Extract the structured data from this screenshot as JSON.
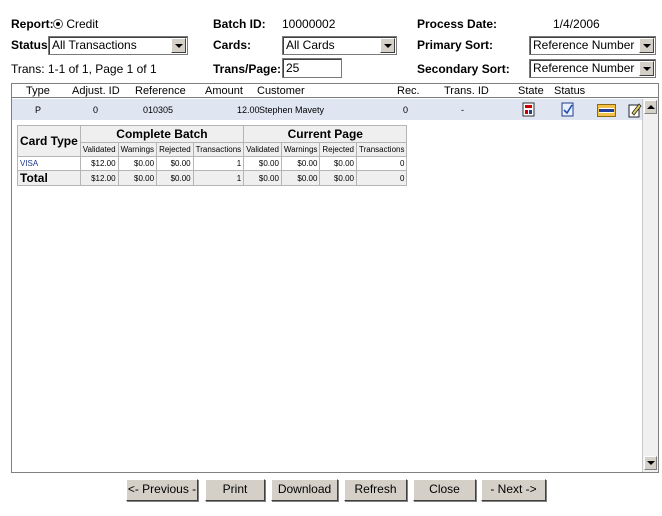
{
  "header": {
    "report_label": "Report:",
    "report_value": "Credit",
    "status_label": "Status:",
    "status_value": "All Transactions",
    "trans_info": "Trans: 1-1 of 1, Page 1 of 1",
    "batch_label": "Batch ID:",
    "batch_value": "10000002",
    "cards_label": "Cards:",
    "cards_value": "All Cards",
    "transpage_label": "Trans/Page:",
    "transpage_value": "25",
    "process_date_label": "Process Date:",
    "process_date_value": "1/4/2006",
    "primary_sort_label": "Primary Sort:",
    "primary_sort_value": "Reference Number",
    "secondary_sort_label": "Secondary Sort:",
    "secondary_sort_value": "Reference Number"
  },
  "columns": [
    "Type",
    "Adjust. ID",
    "Reference",
    "Amount",
    "Customer",
    "Rec.",
    "Trans. ID",
    "State",
    "Status"
  ],
  "row": {
    "type": "P",
    "adjust_id": "0",
    "reference": "010305",
    "amount": "12.00",
    "customer": "Stephen Mavety",
    "rec": "0",
    "trans_id": "-",
    "icons": [
      "state-icon",
      "status-check-icon",
      "visa-card-icon",
      "edit-note-icon"
    ]
  },
  "summary": {
    "card_type_header": "Card Type",
    "complete_batch_header": "Complete Batch",
    "current_page_header": "Current Page",
    "sub_headers": [
      "Validated",
      "Warnings",
      "Rejected",
      "Transactions",
      "Validated",
      "Warnings",
      "Rejected",
      "Transactions"
    ],
    "visa_label": "VISA",
    "visa_values": [
      "$12.00",
      "$0.00",
      "$0.00",
      "1",
      "$0.00",
      "$0.00",
      "$0.00",
      "0"
    ],
    "total_label": "Total",
    "total_values": [
      "$12.00",
      "$0.00",
      "$0.00",
      "1",
      "$0.00",
      "$0.00",
      "$0.00",
      "0"
    ]
  },
  "buttons": {
    "previous": "<- Previous -",
    "print": "Print",
    "download": "Download",
    "refresh": "Refresh",
    "close": "Close",
    "next": "- Next ->"
  },
  "colors": {
    "row_highlight": "#dfe6f2",
    "button_face": "#d4d0c8",
    "visa_blue": "#1a3a8a"
  }
}
